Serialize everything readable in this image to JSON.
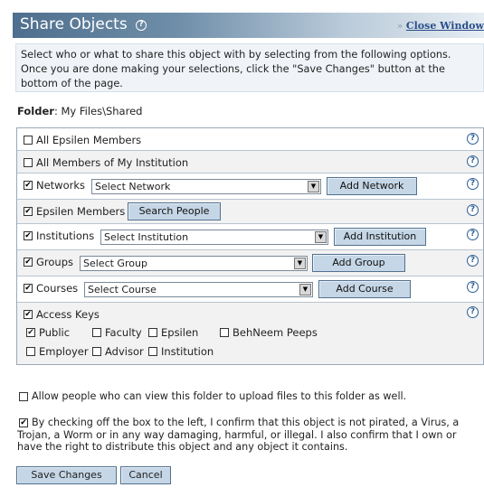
{
  "header": {
    "title": "Share Objects",
    "help_glyph": "?",
    "close_prefix": "»",
    "close_label": "Close Window"
  },
  "intro": "Select who or what to share this object with by selecting from the following options. Once you are done making your selections, click the \"Save Changes\" button at the bottom of the page.",
  "folder": {
    "label": "Folder",
    "path": ": My Files\\Shared"
  },
  "options": {
    "all_members": {
      "label": "All Epsilen Members",
      "checked": false
    },
    "institution_members": {
      "label": "All Members of My Institution",
      "checked": false
    },
    "networks": {
      "label": "Networks",
      "checked": true,
      "select": "Select Network",
      "button": "Add Network"
    },
    "epsilen_members": {
      "label": "Epsilen Members",
      "checked": true,
      "button": "Search People"
    },
    "institutions": {
      "label": "Institutions",
      "checked": true,
      "select": "Select Institution",
      "button": "Add Institution"
    },
    "groups": {
      "label": "Groups",
      "checked": true,
      "select": "Select Group",
      "button": "Add Group"
    },
    "courses": {
      "label": "Courses",
      "checked": true,
      "select": "Select Course",
      "button": "Add Course"
    },
    "access_keys": {
      "label": "Access Keys",
      "checked": true,
      "keys": [
        {
          "label": "Public",
          "checked": true
        },
        {
          "label": "Faculty",
          "checked": false
        },
        {
          "label": "Epsilen",
          "checked": false
        },
        {
          "label": "BehNeem Peeps",
          "checked": false
        },
        {
          "label": "Employer",
          "checked": false
        },
        {
          "label": "Advisor",
          "checked": false
        },
        {
          "label": "Institution",
          "checked": false
        }
      ]
    }
  },
  "allow_upload": {
    "label": "Allow people who can view this folder to upload files to this folder as well.",
    "checked": false
  },
  "confirm": {
    "label": "By checking off the box to the left, I confirm that this object is not pirated, a Virus, a Trojan, a Worm or in any way damaging, harmful, or illegal. I also confirm that I own or have the right to distribute this object and any object it contains.",
    "checked": true
  },
  "buttons": {
    "save": "Save Changes",
    "cancel": "Cancel"
  },
  "check_glyph": "✔",
  "arrow_glyph": "▼",
  "colors": {
    "header_start": "#4e6f8d",
    "button_bg": "#c5d6e6",
    "link": "#2a4f8a"
  }
}
